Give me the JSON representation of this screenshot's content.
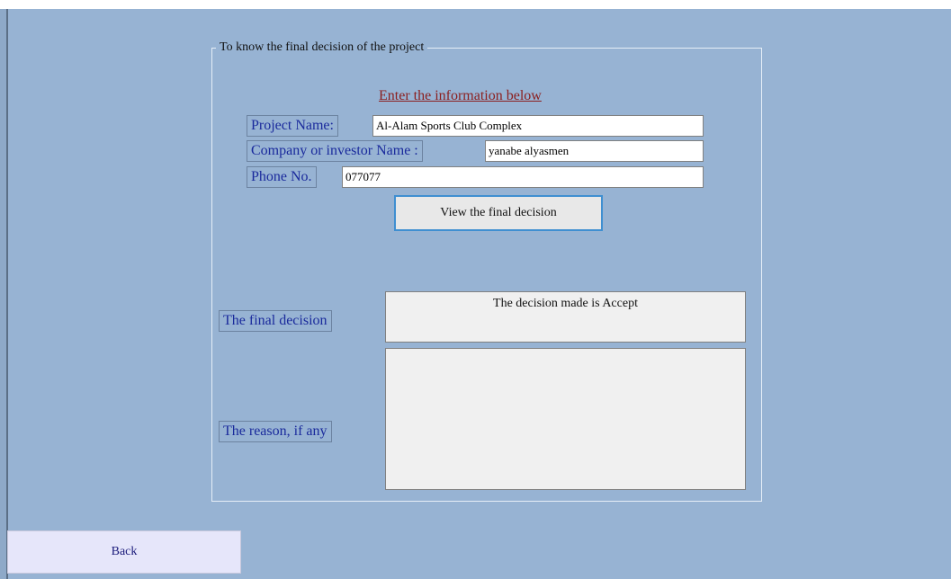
{
  "group": {
    "title": "To know the final decision of the project"
  },
  "instruction": "Enter the information below",
  "form": {
    "project_name_label": "Project Name:",
    "project_name_value": "Al-Alam Sports Club Complex",
    "company_label": "Company or investor Name :",
    "company_value": "yanabe alyasmen",
    "phone_label": "Phone No.",
    "phone_value": "077077"
  },
  "view_button_label": "View the final decision",
  "result": {
    "decision_label": "The final decision",
    "decision_text": "The decision made is Accept",
    "reason_label": "The reason, if any",
    "reason_text": ""
  },
  "back_button_label": "Back"
}
